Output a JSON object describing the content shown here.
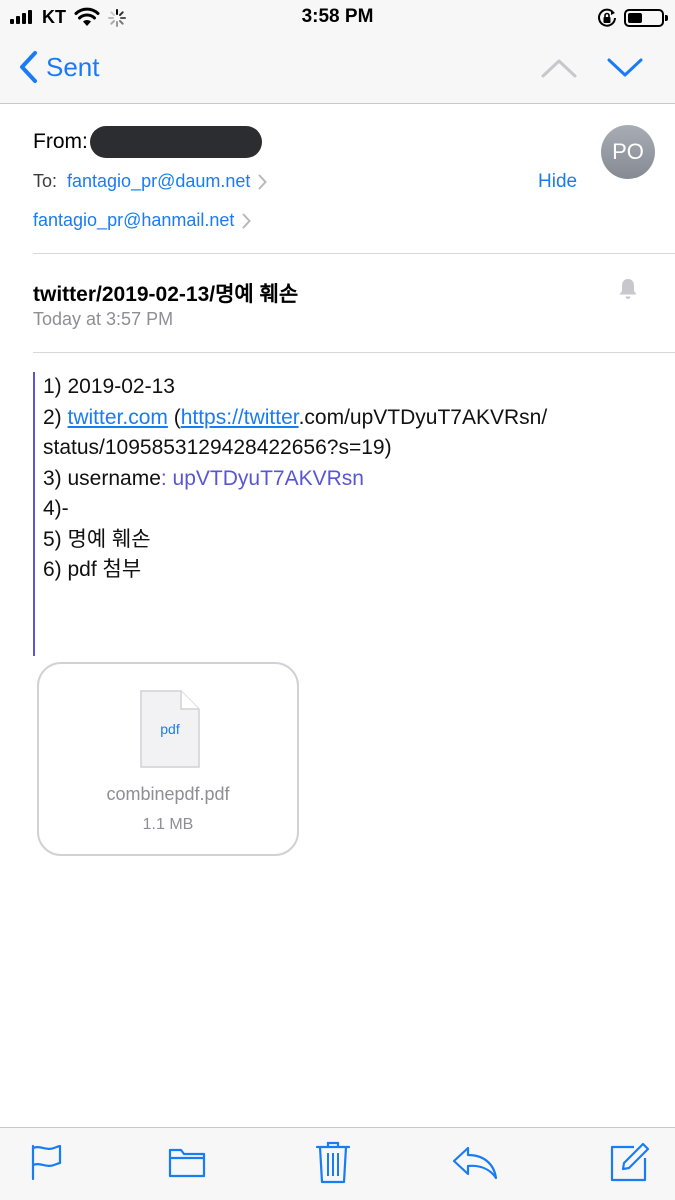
{
  "status_bar": {
    "carrier": "KT",
    "time": "3:58 PM",
    "battery_level": 0.45,
    "icons": [
      "signal-icon",
      "wifi-icon",
      "activity-spinner-icon",
      "rotation-lock-icon",
      "battery-icon"
    ]
  },
  "nav": {
    "back_label": "Sent",
    "icons": [
      "chevron-left-icon",
      "chevron-up-icon",
      "chevron-down-icon"
    ]
  },
  "header": {
    "from_label": "From:",
    "avatar_initials": "PO",
    "to_label": "To:",
    "recipients": [
      "fantagio_pr@daum.net",
      "fantagio_pr@hanmail.net"
    ],
    "hide_label": "Hide",
    "subject": "twitter/2019-02-13/명예 훼손",
    "date": "Today at 3:57 PM"
  },
  "body": {
    "line1": "1) 2019-02-13",
    "line2_prefix": "2) ",
    "line2_link": "twitter.com",
    "line2_mid": " (",
    "line2_url_link": "https://twitter",
    "line2_url_rest": ".com/upVTDyuT7AKVRsn/",
    "line3": "status/1095853129428422656?s=19)",
    "line4_prefix": "3) username",
    "line4_value": ": upVTDyuT7AKVRsn",
    "line5": "4)-",
    "line6": "5) 명예 훼손",
    "line7": "6) pdf 첨부"
  },
  "attachment": {
    "ext": "pdf",
    "name": "combinepdf.pdf",
    "size": "1.1 MB"
  },
  "toolbar": {
    "icons": [
      "flag-icon",
      "folder-icon",
      "trash-icon",
      "reply-icon",
      "compose-icon"
    ]
  },
  "colors": {
    "accent": "#1a7cf4",
    "quote": "#5856d6",
    "secondary_text": "#8e8e93"
  }
}
